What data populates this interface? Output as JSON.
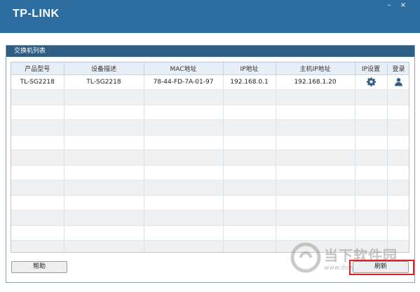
{
  "window": {
    "logo": "TP-LINK",
    "minimize": "–",
    "close": "×"
  },
  "panel": {
    "title": "交换机列表"
  },
  "table": {
    "columns": [
      "产品型号",
      "设备描述",
      "MAC地址",
      "IP地址",
      "主机IP地址",
      "IP设置",
      "登录"
    ],
    "rows": [
      {
        "model": "TL-SG2218",
        "description": "TL-SG2218",
        "mac": "78-44-FD-7A-01-97",
        "ip": "192.168.0.1",
        "host_ip": "192.168.1.20",
        "ip_settings_icon": "gear-icon",
        "login_icon": "user-icon"
      }
    ]
  },
  "buttons": {
    "help": "帮助",
    "refresh": "刷新"
  },
  "watermark": {
    "text": "当下软件园",
    "url": "www.downxia.com"
  },
  "colors": {
    "titlebar": "#2e6da0",
    "panel_header": "#2f5e84",
    "icon": "#2f5e84",
    "highlight": "#e02020"
  }
}
